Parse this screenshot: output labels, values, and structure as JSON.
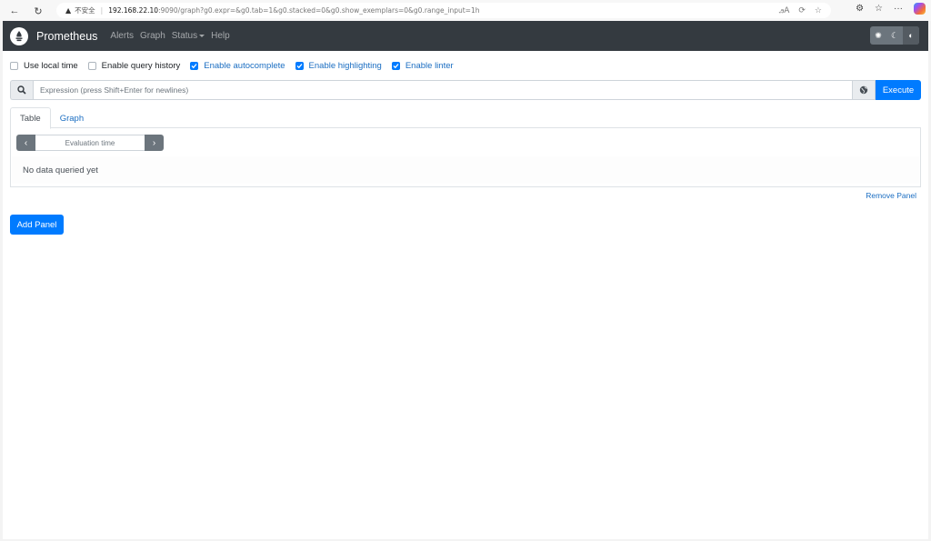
{
  "browser": {
    "insecure_label": "不安全",
    "url_host": "192.168.22.10",
    "url_rest": ":9090/graph?g0.expr=&g0.tab=1&g0.stacked=0&g0.show_exemplars=0&g0.range_input=1h",
    "reader_label": "ꭿA"
  },
  "navbar": {
    "brand": "Prometheus",
    "links": [
      "Alerts",
      "Graph",
      "Status",
      "Help"
    ]
  },
  "options": [
    {
      "label": "Use local time",
      "checked": false
    },
    {
      "label": "Enable query history",
      "checked": false
    },
    {
      "label": "Enable autocomplete",
      "checked": true
    },
    {
      "label": "Enable highlighting",
      "checked": true
    },
    {
      "label": "Enable linter",
      "checked": true
    }
  ],
  "query": {
    "placeholder": "Expression (press Shift+Enter for newlines)",
    "value": "",
    "execute_label": "Execute"
  },
  "panel": {
    "tabs": [
      "Table",
      "Graph"
    ],
    "active_tab": "Table",
    "eval_placeholder": "Evaluation time",
    "empty_text": "No data queried yet",
    "remove_label": "Remove Panel"
  },
  "add_panel_label": "Add Panel",
  "colors": {
    "navbar": "#343a40",
    "primary": "#007bff",
    "link": "#1b6ec2"
  }
}
